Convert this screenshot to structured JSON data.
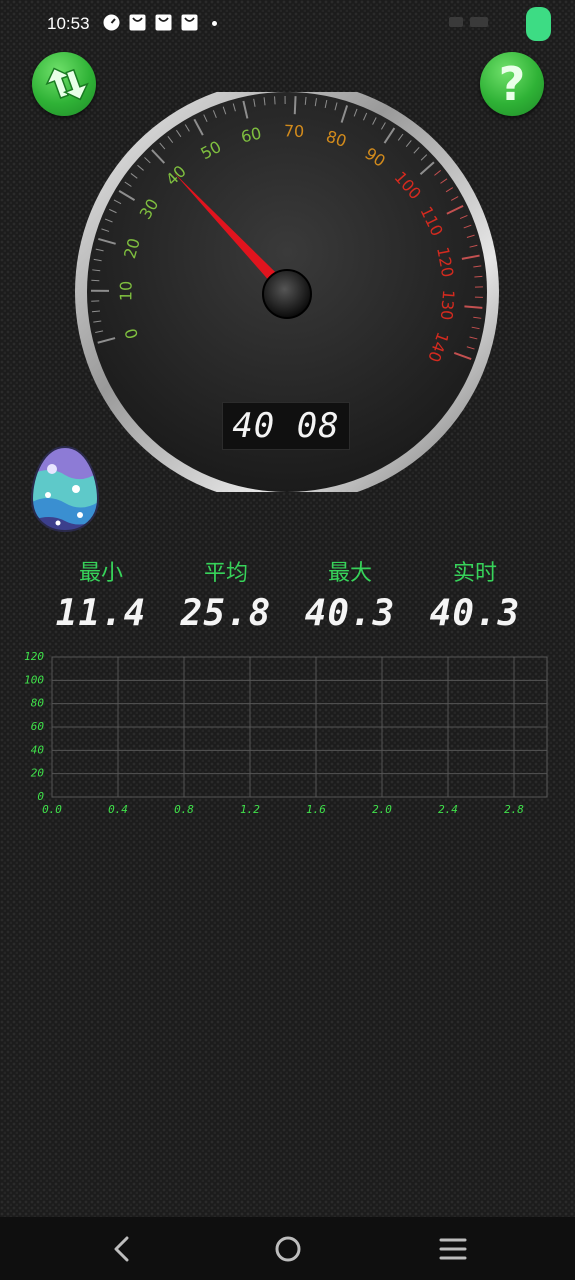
{
  "status_bar": {
    "time": "10:53",
    "icons": [
      "speed-icon",
      "bag-icon",
      "bag-icon",
      "bag-icon",
      "dot-icon"
    ],
    "battery_color": "#3ddc84"
  },
  "toolbar": {
    "refresh_icon": "refresh-arrows-icon",
    "help_label": "?",
    "accent_color": "#2fb236"
  },
  "gauge": {
    "value": 40.08,
    "min": 0,
    "max": 140,
    "tick_labels": [
      "0",
      "10",
      "20",
      "30",
      "40",
      "50",
      "60",
      "70",
      "80",
      "90",
      "100",
      "110",
      "120",
      "130",
      "140"
    ],
    "display": "40 08"
  },
  "stats": [
    {
      "label": "最小",
      "value": "11.4"
    },
    {
      "label": "平均",
      "value": "25.8"
    },
    {
      "label": "最大",
      "value": "40.3"
    },
    {
      "label": "实时",
      "value": "40.3"
    }
  ],
  "chart_data": {
    "type": "line",
    "x_ticks": [
      "0.0",
      "0.4",
      "0.8",
      "1.2",
      "1.6",
      "2.0",
      "2.4",
      "2.8"
    ],
    "y_ticks": [
      "0",
      "20",
      "40",
      "60",
      "80",
      "100",
      "120"
    ],
    "xlim": [
      0,
      3.0
    ],
    "ylim": [
      0,
      120
    ],
    "grid": true,
    "series": [
      {
        "values": []
      }
    ]
  },
  "nav": {
    "back": "back-icon",
    "home": "home-icon",
    "menu": "menu-icon"
  }
}
